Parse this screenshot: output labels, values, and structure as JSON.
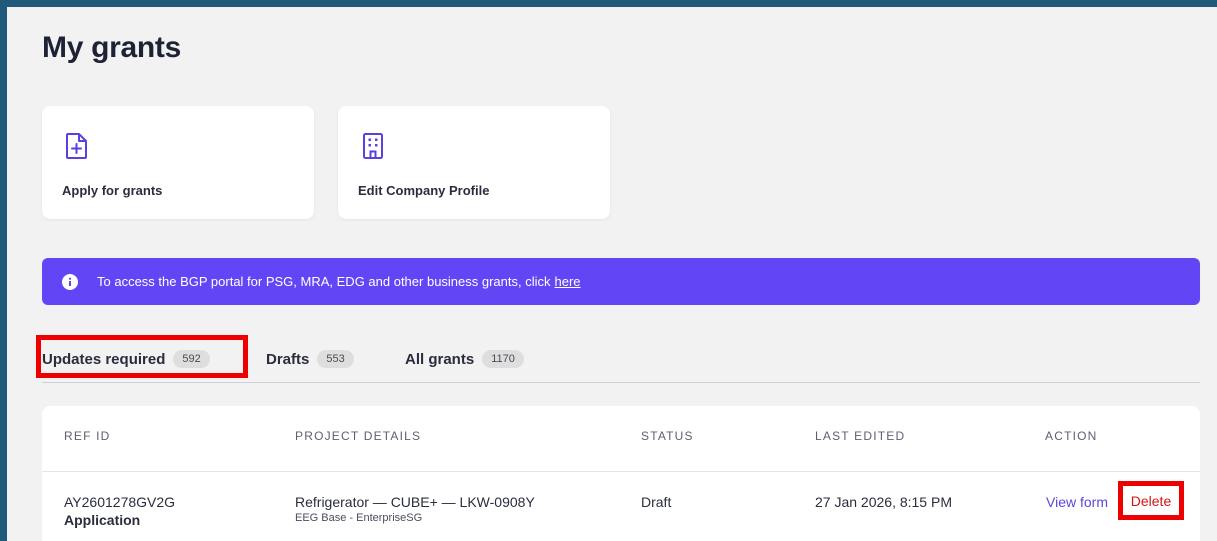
{
  "page": {
    "title": "My grants"
  },
  "cards": [
    {
      "label": "Apply for grants",
      "icon": "file-plus-icon"
    },
    {
      "label": "Edit Company Profile",
      "icon": "building-icon"
    }
  ],
  "banner": {
    "text": "To access the BGP portal for PSG, MRA, EDG and other business grants, click",
    "link": "here",
    "icon": "info-icon"
  },
  "tabs": [
    {
      "label": "Updates required",
      "count": "592"
    },
    {
      "label": "Drafts",
      "count": "553"
    },
    {
      "label": "All grants",
      "count": "1170"
    }
  ],
  "table": {
    "headers": [
      "REF ID",
      "PROJECT DETAILS",
      "STATUS",
      "LAST EDITED",
      "ACTION"
    ],
    "rows": [
      {
        "ref_id": "AY2601278GV2G",
        "type": "Application",
        "project": "Refrigerator — CUBE+ — LKW-0908Y",
        "project_sub": "EEG Base - EnterpriseSG",
        "status": "Draft",
        "last_edited": "27 Jan 2026, 8:15 PM",
        "action_view": "View form",
        "action_delete": "Delete"
      }
    ]
  },
  "colors": {
    "accent": "#6246f5",
    "link": "#5a46e0",
    "danger": "#d41313",
    "highlight": "#ee0000"
  }
}
